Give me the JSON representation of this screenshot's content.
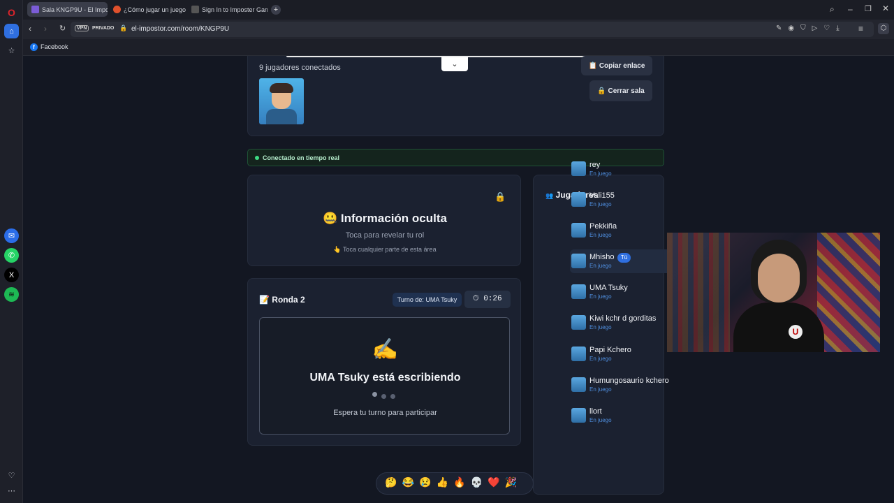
{
  "browser": {
    "tabs": [
      {
        "label": "Sala KNGP9U - El Impostor"
      },
      {
        "label": "¿Cómo jugar un juego tipo"
      },
      {
        "label": "Sign In to Imposter Game"
      }
    ],
    "vpn": "VPN",
    "private": "PRIVADO",
    "url": "el-impostor.com/room/KNGP9U",
    "bookmark": "Facebook"
  },
  "room": {
    "connected_count": "9 jugadores conectados",
    "copy_link": "📋 Copiar enlace",
    "close_room": "🔒 Cerrar sala",
    "realtime": "Conectado en tiempo real"
  },
  "hidden": {
    "emoji": "🤐",
    "title": "Información oculta",
    "subtitle": "Toca para revelar tu rol",
    "hint_icon": "👆",
    "hint": "Toca cualquier parte de esta área",
    "lock": "🔒"
  },
  "round": {
    "title": "Ronda 2",
    "icon": "📝",
    "turn": "Turno de: UMA Tsuky",
    "timer": "0:26",
    "writing_icon": "✍️",
    "writing": "UMA Tsuky está escribiendo",
    "wait": "Espera tu turno para participar"
  },
  "players": {
    "title": "Jugadores",
    "you_badge": "Tú",
    "list": [
      {
        "name": "rey",
        "status": "En juego"
      },
      {
        "name": "Vali155",
        "status": "En juego"
      },
      {
        "name": "Pekkiña",
        "status": "En juego"
      },
      {
        "name": "Mhisho",
        "status": "En juego"
      },
      {
        "name": "UMA Tsuky",
        "status": "En juego"
      },
      {
        "name": "Kiwi kchr d gorditas",
        "status": "En juego"
      },
      {
        "name": "Papi Kchero",
        "status": "En juego"
      },
      {
        "name": "Humungosaurio kchero",
        "status": "En juego"
      },
      {
        "name": "llort",
        "status": "En juego"
      }
    ]
  },
  "reactions": [
    "🤔",
    "😂",
    "😢",
    "👍",
    "🔥",
    "💀",
    "❤️",
    "🎉"
  ],
  "colors": {
    "accent": "#4f8fe0",
    "realtime": "#3ddc84",
    "opera": "#e0242b"
  }
}
